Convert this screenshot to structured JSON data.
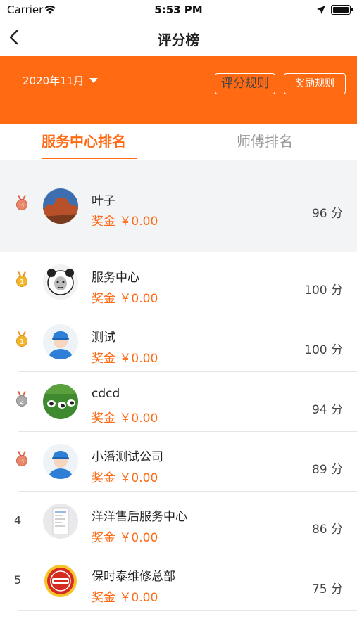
{
  "status_bar": {
    "carrier": "Carrier",
    "time": "5:53 PM"
  },
  "nav": {
    "title": "评分榜"
  },
  "banner": {
    "month": "2020年11月",
    "score_rules": "评分规则",
    "reward_rules": "奖励规则"
  },
  "tabs": {
    "service_center": "服务中心排名",
    "master": "师傅排名"
  },
  "list": [
    {
      "rank": "3",
      "medal": "bronze",
      "name": "叶子",
      "bonus": "奖金 ￥0.00",
      "score": "96 分",
      "avatar": "canyon"
    },
    {
      "rank": "1",
      "medal": "gold",
      "name": "服务中心",
      "bonus": "奖金 ￥0.00",
      "score": "100 分",
      "avatar": "meme"
    },
    {
      "rank": "1",
      "medal": "gold",
      "name": "测试",
      "bonus": "奖金 ￥0.00",
      "score": "100 分",
      "avatar": "worker"
    },
    {
      "rank": "2",
      "medal": "silver",
      "name": "cdcd",
      "bonus": "奖金 ￥0.00",
      "score": "94 分",
      "avatar": "pandas"
    },
    {
      "rank": "3",
      "medal": "bronze",
      "name": "小潘测试公司",
      "bonus": "奖金 ￥0.00",
      "score": "89 分",
      "avatar": "worker"
    },
    {
      "rank": "4",
      "medal": "",
      "name": "洋洋售后服务中心",
      "bonus": "奖金 ￥0.00",
      "score": "86 分",
      "avatar": "screenshot"
    },
    {
      "rank": "5",
      "medal": "",
      "name": "保时泰维修总部",
      "bonus": "奖金 ￥0.00",
      "score": "75 分",
      "avatar": "logo"
    }
  ],
  "colors": {
    "accent": "#ff6a13",
    "gold": "#f5a623",
    "silver": "#9b9b9b",
    "bronze": "#e07850"
  }
}
